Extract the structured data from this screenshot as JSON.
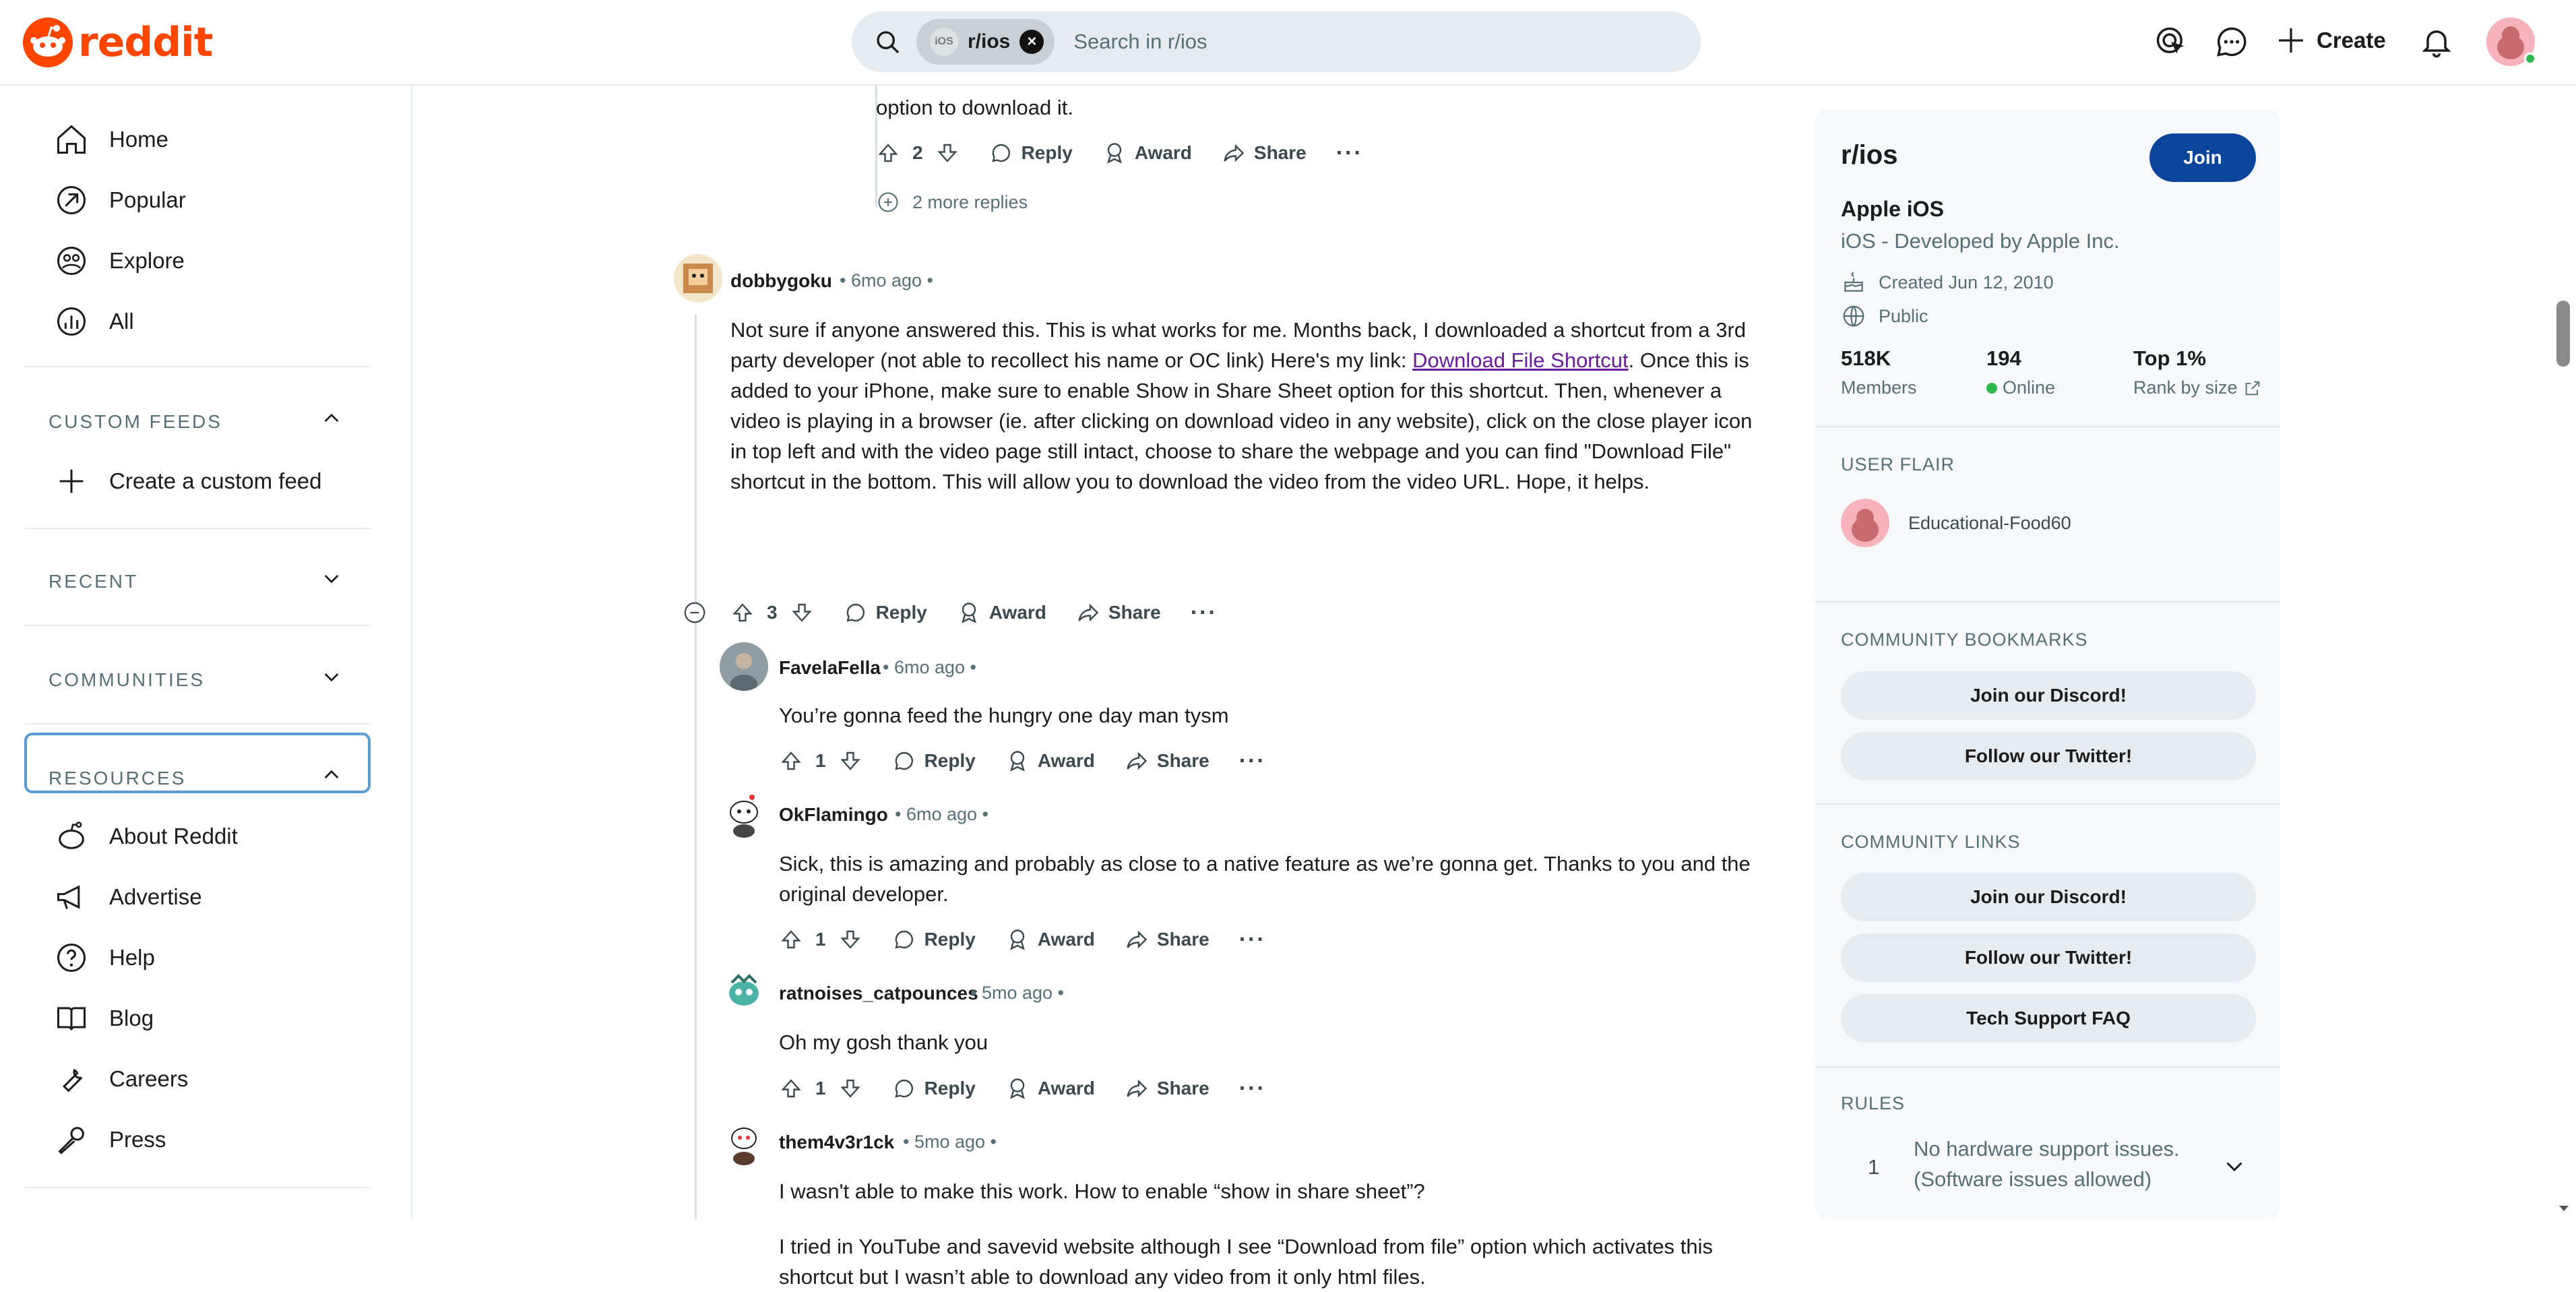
{
  "header": {
    "logo_text": "reddit",
    "search_chip": "r/ios",
    "search_placeholder": "Search in r/ios",
    "create_label": "Create"
  },
  "sidebar": {
    "nav": [
      "Home",
      "Popular",
      "Explore",
      "All"
    ],
    "custom_feeds_title": "CUSTOM FEEDS",
    "create_feed_label": "Create a custom feed",
    "recent_title": "RECENT",
    "communities_title": "COMMUNITIES",
    "resources_title": "RESOURCES",
    "resources": [
      "About Reddit",
      "Advertise",
      "Help",
      "Blog",
      "Careers",
      "Press"
    ]
  },
  "thread": {
    "prev_comment_tail": "option to download it.",
    "prev_votes": "2",
    "more_replies": "2 more replies",
    "action_labels": {
      "reply": "Reply",
      "award": "Award",
      "share": "Share"
    },
    "comments": [
      {
        "user": "dobbygoku",
        "time": "6mo ago",
        "body_pre": "Not sure if anyone answered this. This is what works for me. Months back, I downloaded a shortcut from a 3rd party developer (not able to recollect his name or OC link) Here's my link: ",
        "link": "Download File Shortcut",
        "body_post": ". Once this is added to your iPhone, make sure to enable Show in Share Sheet option for this shortcut. Then, whenever a video is playing in a browser (ie. after clicking on download video in any website), click on the close player icon in top left and with the video page still intact, choose to share the webpage and you can find \"Download File\" shortcut in the bottom. This will allow you to download the video from the video URL. Hope, it helps.",
        "votes": "3"
      },
      {
        "user": "FavelaFella",
        "time": "6mo ago",
        "body": "You’re gonna feed the hungry one day man tysm",
        "votes": "1"
      },
      {
        "user": "OkFlamingo",
        "time": "6mo ago",
        "body": "Sick, this is amazing and probably as close to a native feature as we’re gonna get. Thanks to you and the original developer.",
        "votes": "1"
      },
      {
        "user": "ratnoises_catpounces",
        "time": "5mo ago",
        "body": "Oh my gosh thank you",
        "votes": "1"
      },
      {
        "user": "them4v3r1ck",
        "time": "5mo ago",
        "body": "I wasn't able to make this work. How to enable “show in share sheet”?",
        "body2": "I tried in YouTube and savevid website although I see “Download from file” option which activates this shortcut but I wasn’t able to download any video from it only html files."
      }
    ]
  },
  "right_sidebar": {
    "sub_name": "r/ios",
    "join_label": "Join",
    "title": "Apple iOS",
    "description": "iOS - Developed by Apple Inc.",
    "created": "Created Jun 12, 2010",
    "visibility": "Public",
    "members_value": "518K",
    "members_label": "Members",
    "online_value": "194",
    "online_label": "Online",
    "rank_value": "Top 1%",
    "rank_label": "Rank by size",
    "user_flair_title": "USER FLAIR",
    "flair_user": "Educational-Food60",
    "bookmarks_title": "COMMUNITY BOOKMARKS",
    "bookmarks": [
      "Join our Discord!",
      "Follow our Twitter!"
    ],
    "links_title": "COMMUNITY LINKS",
    "links": [
      "Join our Discord!",
      "Follow our Twitter!",
      "Tech Support FAQ"
    ],
    "rules_title": "RULES",
    "rule_1_num": "1",
    "rule_1_text": "No hardware support issues. (Software issues allowed)"
  },
  "colors": {
    "brand": "#ff4500",
    "join": "#0a449b",
    "link": "#6a1b9a",
    "online": "#2db84d"
  }
}
